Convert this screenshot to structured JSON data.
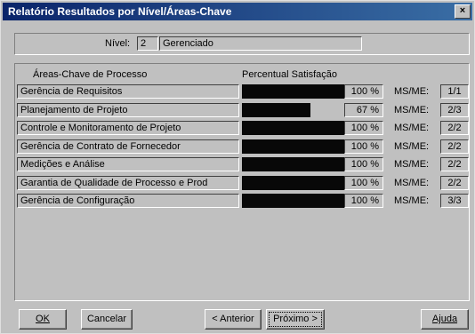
{
  "window": {
    "title": "Relatório Resultados por Nível/Áreas-Chave",
    "close": "×"
  },
  "level": {
    "label": "Nível:",
    "number": "2",
    "name": "Gerenciado"
  },
  "table": {
    "col_area": "Áreas-Chave de Processo",
    "col_pct": "Percentual Satisfação",
    "ms_label": "MS/ME:",
    "rows": [
      {
        "name": "Gerência de Requisitos",
        "fraction": 1.0,
        "pct": "100 %",
        "ms": "1/1"
      },
      {
        "name": "Planejamento de Projeto",
        "fraction": 0.67,
        "pct": "67 %",
        "ms": "2/3"
      },
      {
        "name": "Controle e Monitoramento de Projeto",
        "fraction": 1.0,
        "pct": "100 %",
        "ms": "2/2"
      },
      {
        "name": "Gerência de Contrato de Fornecedor",
        "fraction": 1.0,
        "pct": "100 %",
        "ms": "2/2"
      },
      {
        "name": "Medições e Análise",
        "fraction": 1.0,
        "pct": "100 %",
        "ms": "2/2"
      },
      {
        "name": "Garantia de Qualidade de Processo e Prod",
        "fraction": 1.0,
        "pct": "100 %",
        "ms": "2/2"
      },
      {
        "name": "Gerência de Configuração",
        "fraction": 1.0,
        "pct": "100 %",
        "ms": "3/3"
      }
    ]
  },
  "buttons": {
    "ok": "OK",
    "cancel": "Cancelar",
    "prev": "< Anterior",
    "next": "Próximo >",
    "help": "Ajuda"
  },
  "colors": {
    "bar": "#080808",
    "title_start": "#0a246a",
    "title_end": "#3a6ea5"
  }
}
